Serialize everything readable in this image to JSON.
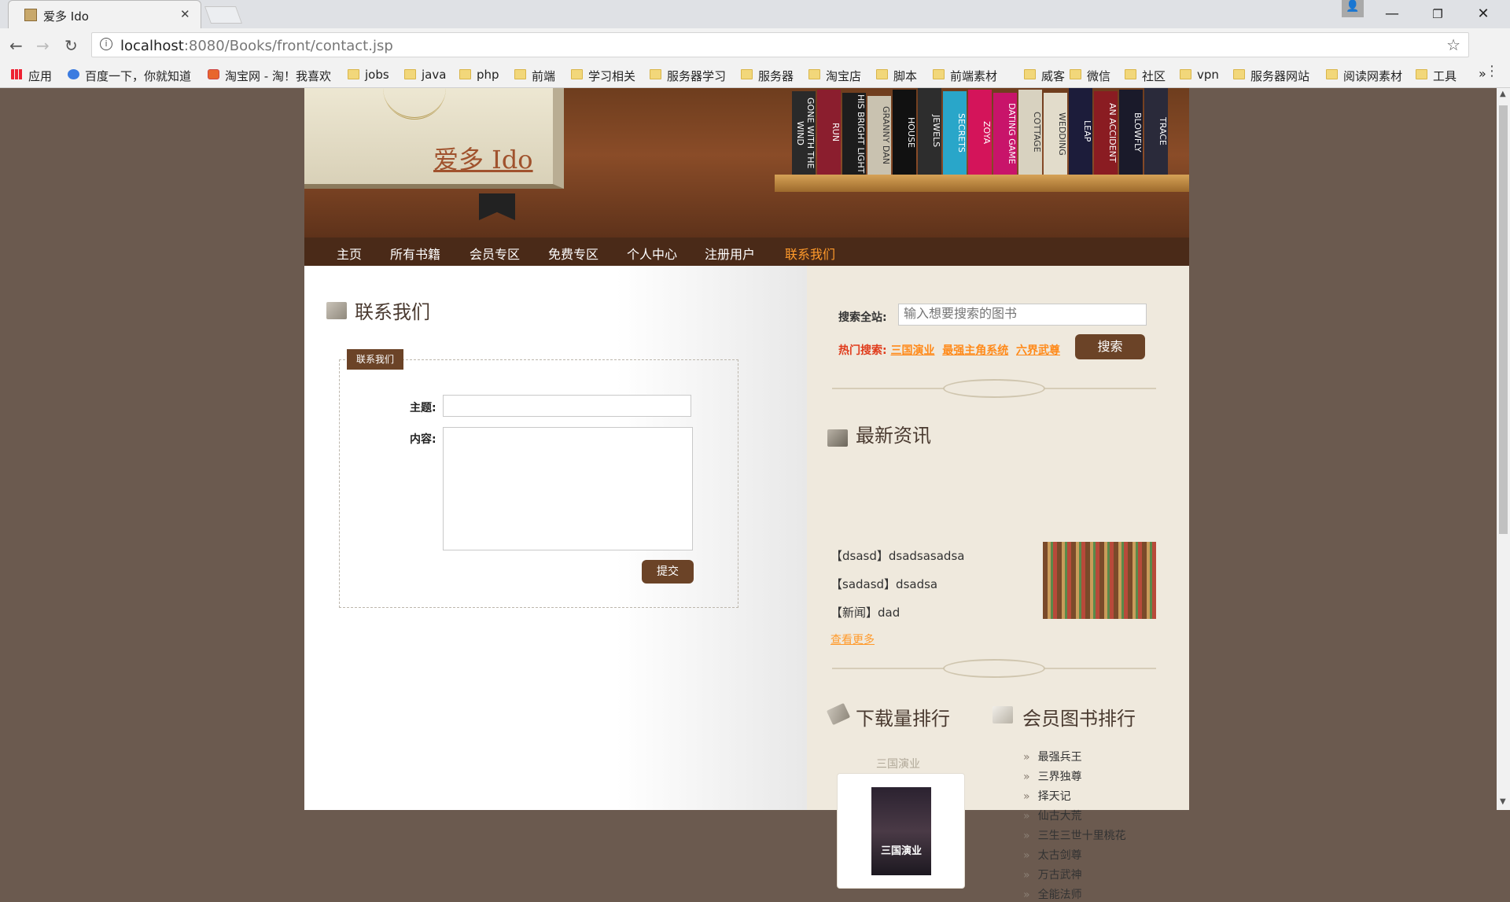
{
  "browser": {
    "tab_title": "爱多 Ido",
    "url_host": "localhost",
    "url_rest": ":8080/Books/front/contact.jsp",
    "bookmarks": [
      "应用",
      "百度一下，你就知道",
      "淘宝网 - 淘！我喜欢",
      "jobs",
      "java",
      "php",
      "前端",
      "学习相关",
      "服务器学习",
      "服务器",
      "淘宝店",
      "脚本",
      "前端素材",
      "威客",
      "微信",
      "社区",
      "vpn",
      "服务器网站",
      "阅读网素材",
      "工具"
    ]
  },
  "header": {
    "brand": "爱多 Ido",
    "book_spines": [
      "GONE WITH THE WIND",
      "RUN",
      "HIS BRIGHT LIGHT",
      "GRANNY DAN",
      "HOUSE",
      "JEWELS",
      "SECRETS",
      "ZOYA",
      "DATING GAME",
      "COTTAGE",
      "WEDDING",
      "LEAP",
      "AN ACCIDENT",
      "BLOWFLY",
      "TRACE"
    ]
  },
  "nav": {
    "items": [
      "主页",
      "所有书籍",
      "会员专区",
      "免费专区",
      "个人中心",
      "注册用户",
      "联系我们"
    ],
    "active_index": 6
  },
  "contact": {
    "section_title": "联系我们",
    "legend": "联系我们",
    "subject_label": "主题:",
    "content_label": "内容:",
    "submit_label": "提交"
  },
  "sidebar": {
    "search_label": "搜索全站:",
    "search_placeholder": "输入想要搜索的图书",
    "search_button": "搜索",
    "hot_label": "热门搜索:",
    "hot_items": [
      "三国演业",
      "最强主角系统",
      "六界武尊"
    ],
    "news_title": "最新资讯",
    "news": [
      "【dsasd】dsadsasadsa",
      "【sadasd】dsadsa",
      "【新闻】dad"
    ],
    "news_more": "查看更多",
    "download_rank_title": "下载量排行",
    "download_book_caption": "三国演业",
    "download_book_cover_title": "三国演业",
    "member_rank_title": "会员图书排行",
    "member_rank": [
      "最强兵王",
      "三界独尊",
      "择天记",
      "仙古大荒",
      "三生三世十里桃花",
      "太古剑尊",
      "万古武神",
      "全能法师"
    ]
  }
}
